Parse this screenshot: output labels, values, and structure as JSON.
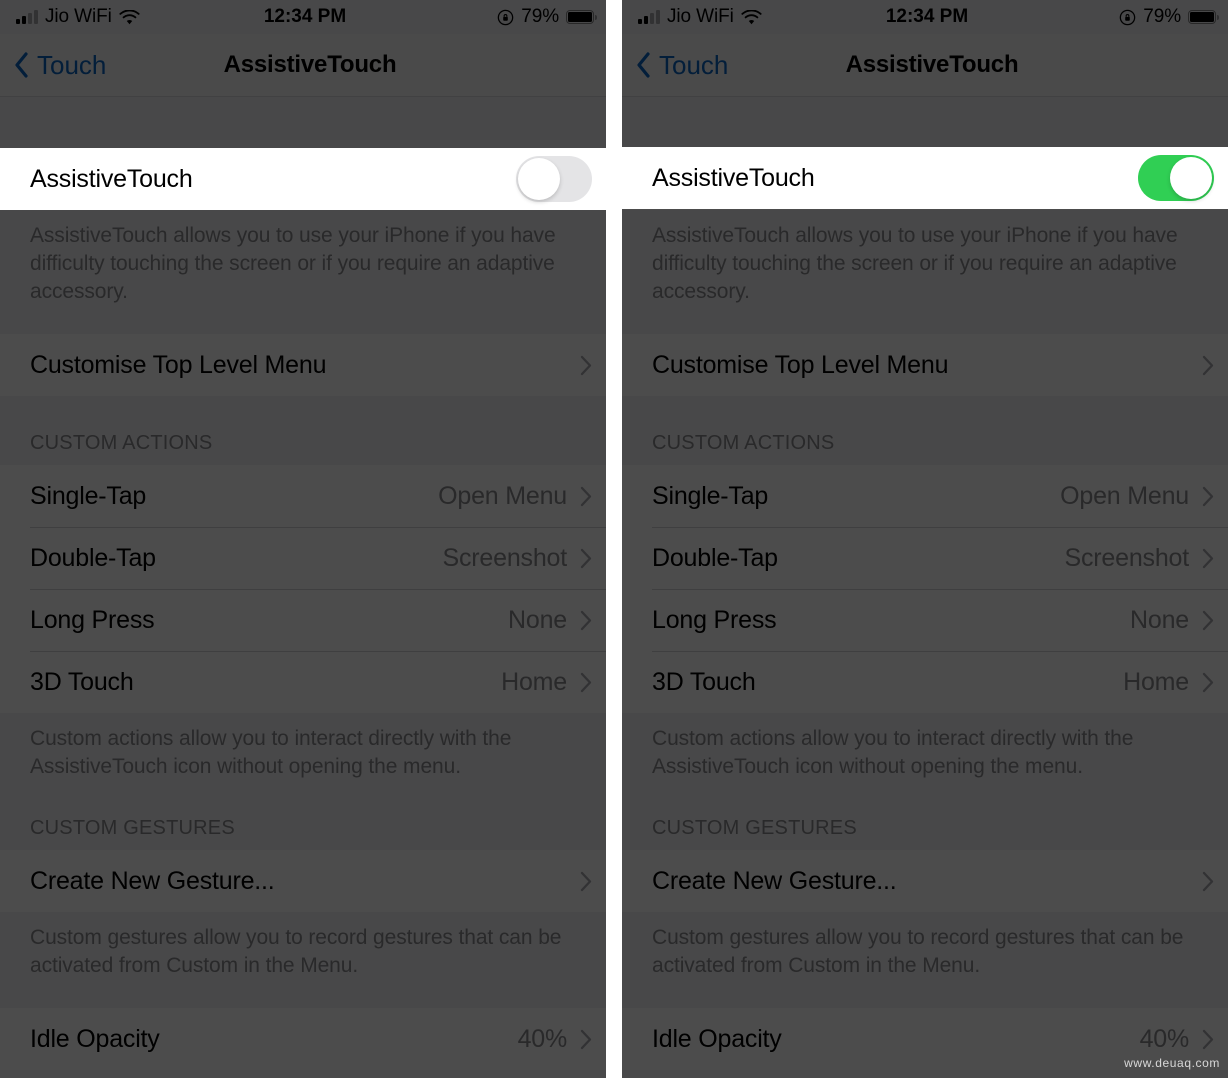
{
  "status_bar": {
    "carrier": "Jio WiFi",
    "time": "12:34 PM",
    "battery_percent": "79%",
    "signal_icon": "signal-bars-icon",
    "wifi_icon": "wifi-icon",
    "rotation_lock_icon": "rotation-lock-icon",
    "battery_icon": "battery-icon"
  },
  "nav": {
    "back_label": "Touch",
    "back_icon": "chevron-left-icon",
    "title": "AssistiveTouch"
  },
  "toggle_row": {
    "label": "AssistiveTouch",
    "left_state": "off",
    "right_state": "on",
    "on_color": "#30CF54",
    "off_color": "#E4E4E6"
  },
  "footnotes": {
    "assistive_touch": "AssistiveTouch allows you to use your iPhone if you have difficulty touching the screen or if you require an adaptive accessory.",
    "custom_actions": "Custom actions allow you to interact directly with the AssistiveTouch icon without opening the menu.",
    "custom_gestures": "Custom gestures allow you to record gestures that can be activated from Custom in the Menu."
  },
  "menu_row": {
    "label": "Customise Top Level Menu",
    "chevron_icon": "chevron-right-icon"
  },
  "sections": [
    {
      "header": "CUSTOM ACTIONS",
      "rows": [
        {
          "label": "Single-Tap",
          "value": "Open Menu"
        },
        {
          "label": "Double-Tap",
          "value": "Screenshot"
        },
        {
          "label": "Long Press",
          "value": "None"
        },
        {
          "label": "3D Touch",
          "value": "Home"
        }
      ]
    },
    {
      "header": "CUSTOM GESTURES",
      "rows": [
        {
          "label": "Create New Gesture...",
          "value": ""
        }
      ]
    }
  ],
  "idle_opacity_row": {
    "label": "Idle Opacity",
    "value": "40%"
  },
  "watermark": "www.deuaq.com"
}
